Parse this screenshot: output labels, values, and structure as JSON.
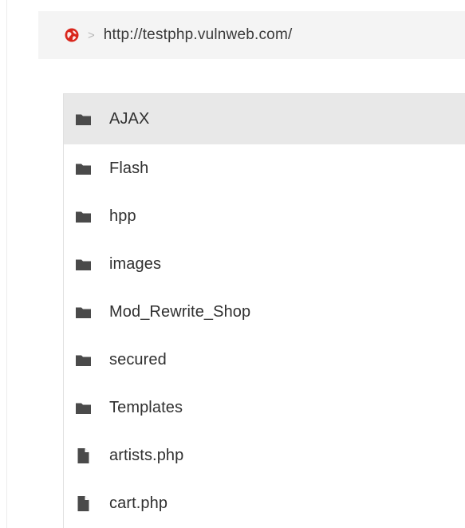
{
  "breadcrumb": {
    "icon": "globe-icon",
    "separator": ">",
    "url": "http://testphp.vulnweb.com/"
  },
  "listing": {
    "items": [
      {
        "name": "AJAX",
        "type": "folder",
        "icon": "folder-icon",
        "selected": true
      },
      {
        "name": "Flash",
        "type": "folder",
        "icon": "folder-icon"
      },
      {
        "name": "hpp",
        "type": "folder",
        "icon": "folder-icon"
      },
      {
        "name": "images",
        "type": "folder",
        "icon": "folder-icon"
      },
      {
        "name": "Mod_Rewrite_Shop",
        "type": "folder",
        "icon": "folder-icon"
      },
      {
        "name": "secured",
        "type": "folder",
        "icon": "folder-icon"
      },
      {
        "name": "Templates",
        "type": "folder",
        "icon": "folder-icon"
      },
      {
        "name": "artists.php",
        "type": "file",
        "icon": "file-icon"
      },
      {
        "name": "cart.php",
        "type": "file",
        "icon": "file-icon"
      }
    ]
  },
  "colors": {
    "globe_icon": "#d9261c",
    "icon_gray": "#4a4a4a",
    "selected_row": "#e8e8e8",
    "breadcrumb_bg": "#f4f4f4"
  }
}
